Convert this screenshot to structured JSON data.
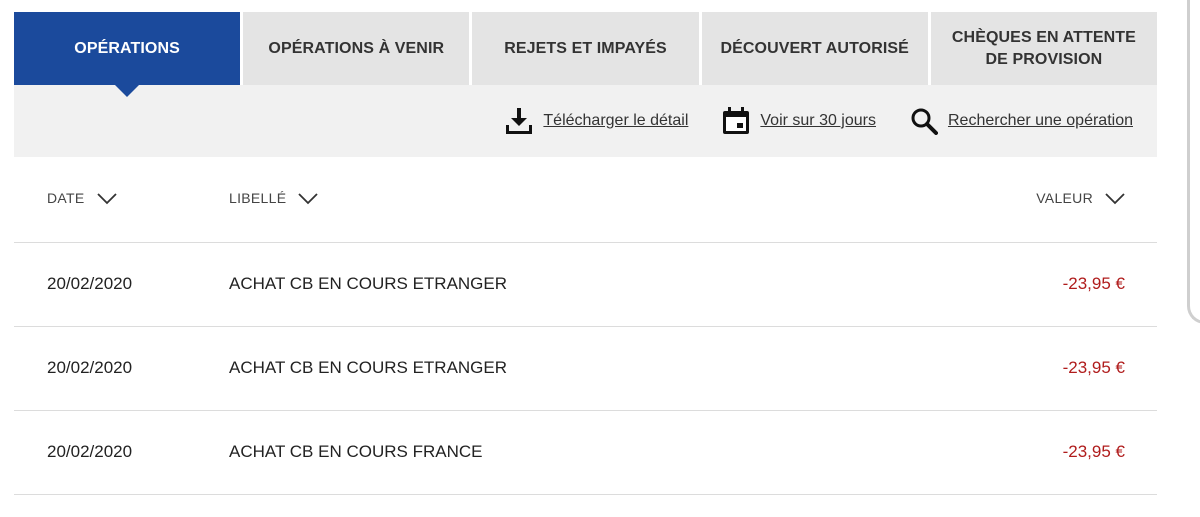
{
  "tabs": [
    {
      "label": "OPÉRATIONS",
      "active": true
    },
    {
      "label": "OPÉRATIONS À VENIR",
      "active": false
    },
    {
      "label": "REJETS ET IMPAYÉS",
      "active": false
    },
    {
      "label": "DÉCOUVERT AUTORISÉ",
      "active": false
    },
    {
      "label": "CHÈQUES EN ATTENTE DE PROVISION",
      "active": false
    }
  ],
  "toolbar": {
    "download_label": "Télécharger le détail",
    "download_icon": "download-icon",
    "days30_label": "Voir sur 30 jours",
    "days30_icon": "calendar-icon",
    "search_label": "Rechercher une opération",
    "search_icon": "search-icon"
  },
  "table": {
    "headers": {
      "date": "DATE",
      "libelle": "LIBELLÉ",
      "valeur": "VALEUR"
    },
    "rows": [
      {
        "date": "20/02/2020",
        "libelle": "ACHAT CB EN COURS ETRANGER",
        "valeur": "-23,95 €"
      },
      {
        "date": "20/02/2020",
        "libelle": "ACHAT CB EN COURS ETRANGER",
        "valeur": "-23,95 €"
      },
      {
        "date": "20/02/2020",
        "libelle": "ACHAT CB EN COURS FRANCE",
        "valeur": "-23,95 €"
      }
    ]
  },
  "colors": {
    "active_tab": "#1b4a9c",
    "inactive_tab": "#e4e4e4",
    "toolbar_bg": "#f1f1f1",
    "negative_amount": "#b01c1c"
  }
}
